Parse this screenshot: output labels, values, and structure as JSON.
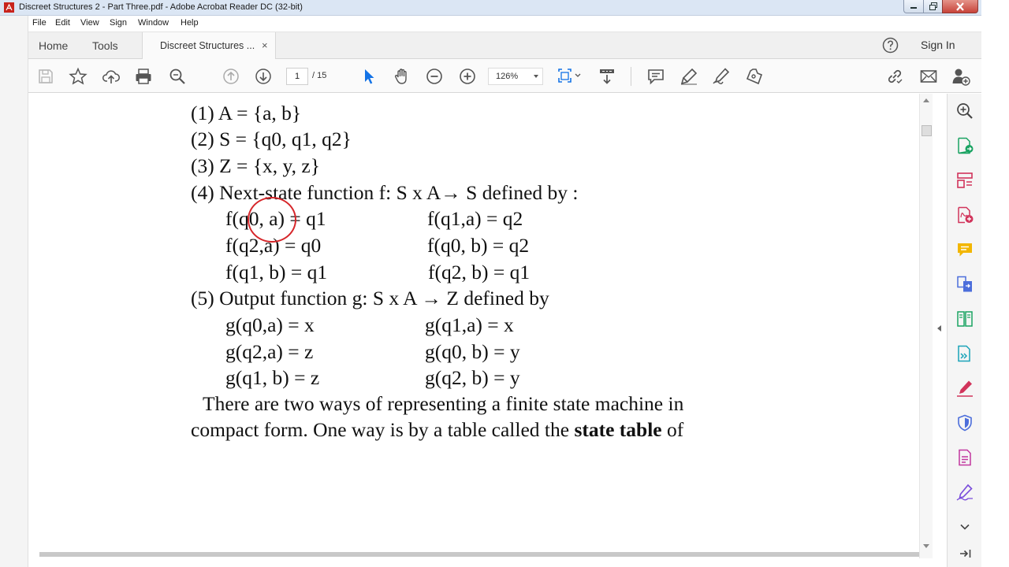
{
  "window": {
    "title": "Discreet Structures 2 - Part Three.pdf - Adobe Acrobat Reader DC (32-bit)"
  },
  "menu": [
    "File",
    "Edit",
    "View",
    "Sign",
    "Window",
    "Help"
  ],
  "tabs": {
    "home": "Home",
    "tools": "Tools",
    "document": "Discreet Structures ...",
    "close": "×",
    "sign_in": "Sign In"
  },
  "toolbar": {
    "page_current": "1",
    "page_total": "/ 15",
    "zoom": "126%"
  },
  "document": {
    "lines": [
      "(1) A = {a, b}",
      "(2) S = {q0, q1, q2}",
      "(3) Z = {x, y, z}",
      "(4)  Next-state function f: S x A→ S    defined by :",
      "f(q0, a) = q1",
      "f(q1,a) = q2",
      "f(q2,a) = q0",
      "f(q0, b) = q2",
      "f(q1, b) = q1",
      "f(q2, b) = q1",
      "(5)  Output function g: S x A → Z  defined by",
      "g(q0,a) = x",
      "g(q1,a) = x",
      "g(q2,a) = z",
      "g(q0, b) = y",
      "g(q1, b) = z",
      "g(q2, b) = y",
      "There are two ways of representing a finite state machine in",
      "compact form. One way is by a table called the ",
      "state table",
      " of"
    ]
  },
  "colors": {
    "annotation": "#d6262a",
    "toolbar_icon": "#555555",
    "select_tool": "#1473e6"
  },
  "icons": {
    "toolbar": [
      "save-icon",
      "bookmark-star-icon",
      "upload-cloud-icon",
      "print-icon",
      "zoom-search-icon",
      "page-up-icon",
      "page-down-icon",
      "select-cursor-icon",
      "hand-icon",
      "zoom-out-icon",
      "zoom-in-icon",
      "fit-page-icon",
      "scroll-mode-icon",
      "comment-icon",
      "highlight-pen-icon",
      "fill-sign-icon",
      "stamp-icon",
      "link-icon",
      "mail-icon",
      "add-user-icon"
    ],
    "right_panel": [
      "zoom-icon",
      "export-pdf-icon",
      "organize-pages-icon",
      "create-pdf-icon",
      "comment-tool-icon",
      "combine-files-icon",
      "compare-icon",
      "send-review-icon",
      "fill-sign-tool-icon",
      "protect-icon",
      "edit-pdf-icon",
      "signature-icon",
      "more-tools-chevron-icon",
      "collapse-panel-icon"
    ]
  }
}
